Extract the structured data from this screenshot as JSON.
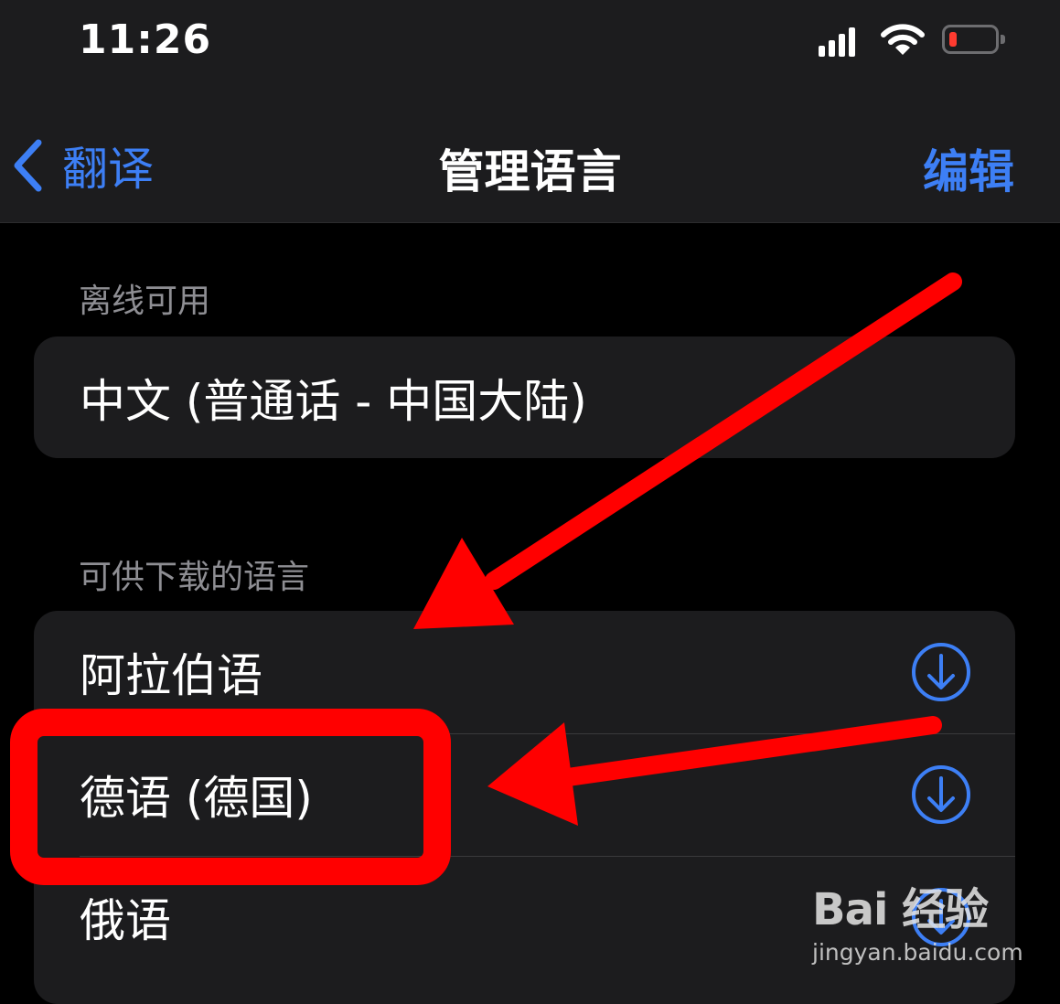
{
  "status_bar": {
    "time": "11:26"
  },
  "nav": {
    "back_label": "翻译",
    "title": "管理语言",
    "edit_label": "编辑"
  },
  "offline": {
    "header": "离线可用",
    "items": [
      {
        "label": "中文 (普通话 - 中国大陆)"
      }
    ]
  },
  "downloadable": {
    "header": "可供下载的语言",
    "items": [
      {
        "label": "阿拉伯语",
        "icon": "download-icon"
      },
      {
        "label": "德语 (德国)",
        "icon": "download-icon"
      },
      {
        "label": "俄语",
        "icon": "download-icon"
      }
    ]
  },
  "watermark": {
    "logo": "Bai 经验",
    "url": "jingyan.baidu.com"
  },
  "colors": {
    "accent": "#3d7ff5",
    "annotation": "#ff0000",
    "background": "#000000",
    "cell": "#1c1c1e"
  }
}
